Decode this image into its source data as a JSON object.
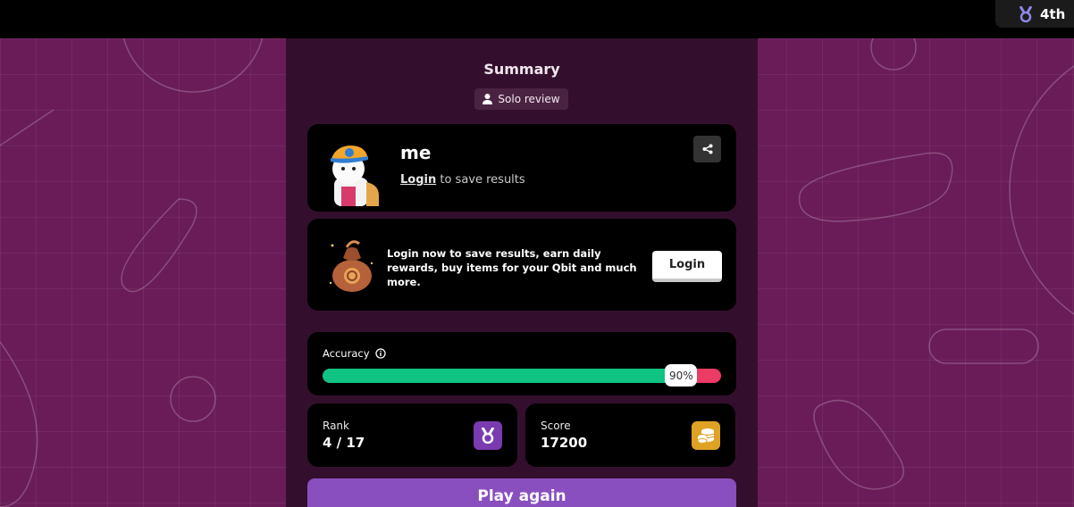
{
  "topbar": {
    "rank_badge": "4th",
    "rank_icon": "medal-icon"
  },
  "summary": {
    "title": "Summary",
    "mode_label": "Solo review",
    "mode_icon": "user-icon"
  },
  "player": {
    "name": "me",
    "login_link": "Login",
    "save_text": " to save results",
    "share_icon": "share-icon"
  },
  "promo": {
    "text": "Login now to save results, earn daily rewards, buy items for your Qbit and much more.",
    "button": "Login"
  },
  "accuracy": {
    "label": "Accuracy",
    "info_icon": "info-icon",
    "value": 90,
    "value_label": "90%"
  },
  "rank": {
    "label": "Rank",
    "value": "4 / 17",
    "icon": "medal-icon",
    "color": "#7a3bb0"
  },
  "score": {
    "label": "Score",
    "value": "17200",
    "icon": "coins-icon",
    "color": "#e0a224"
  },
  "actions": {
    "play_again": "Play again"
  },
  "colors": {
    "background": "#6a1c59",
    "panel": "#340f2d",
    "accuracy_correct": "#0fc483",
    "accuracy_wrong": "#ec3b64",
    "play_button": "#8a4fbf"
  }
}
